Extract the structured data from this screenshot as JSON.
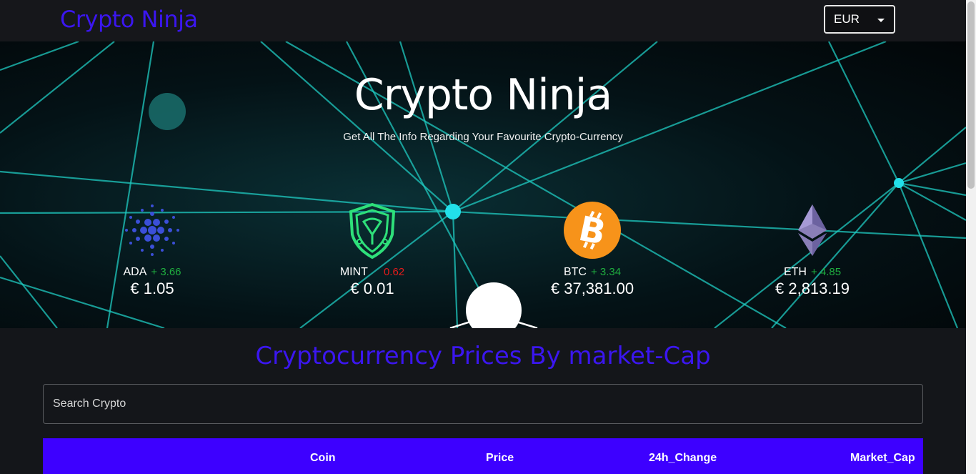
{
  "header": {
    "logo": "Crypto Ninja",
    "currency": "EUR"
  },
  "hero": {
    "title": "Crypto Ninja",
    "subtitle": "Get All The Info Regarding Your Favourite Crypto-Currency",
    "coins": [
      {
        "symbol": "ADA",
        "change": "+ 3.66",
        "price": "€ 1.05",
        "icon": "cardano-icon"
      },
      {
        "symbol": "MINT",
        "change": "0.62",
        "price": "€ 0.01",
        "icon": "mint-shield-icon"
      },
      {
        "symbol": "BTC",
        "change": "+ 3.34",
        "price": "€ 37,381.00",
        "icon": "bitcoin-icon"
      },
      {
        "symbol": "ETH",
        "change": "+ 4.85",
        "price": "€ 2,813.19",
        "icon": "ethereum-icon"
      }
    ]
  },
  "main": {
    "section_title": "Cryptocurrency Prices By market-Cap",
    "search_placeholder": "Search Crypto",
    "columns": [
      "Coin",
      "Price",
      "24h_Change",
      "Market_Cap"
    ]
  },
  "colors": {
    "brand": "#3b16f0",
    "table_header": "#3d00ff",
    "positive": "#1fae3f",
    "negative": "#e41b1b"
  }
}
